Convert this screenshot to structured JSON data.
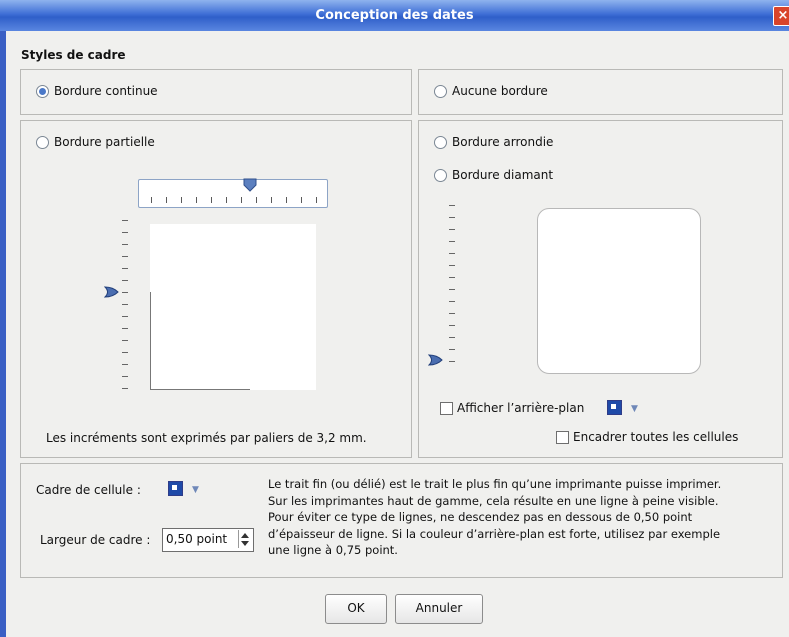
{
  "window": {
    "title": "Conception des dates",
    "close_symbol": "×"
  },
  "frame_styles": {
    "heading": "Styles de cadre",
    "continuous": {
      "label": "Bordure continue",
      "checked": true
    },
    "none": {
      "label": "Aucune bordure",
      "checked": false
    },
    "partial": {
      "label": "Bordure partielle",
      "checked": false
    },
    "rounded": {
      "label": "Bordure arrondie",
      "checked": false
    },
    "diamond": {
      "label": "Bordure diamant",
      "checked": false
    },
    "increments_note": "Les incréments sont exprimés par paliers de 3,2 mm.",
    "show_background": {
      "label": "Afficher l’arrière-plan",
      "checked": false
    },
    "frame_all_cells": {
      "label": "Encadrer toutes les cellules",
      "checked": false
    }
  },
  "cell": {
    "frame_label": "Cadre de cellule :",
    "width_label": "Largeur de cadre :",
    "width_value": "0,50 point",
    "help_text": "Le trait fin (ou délié) est le trait le plus fin qu’une imprimante puisse imprimer. Sur les imprimantes haut de gamme, cela résulte en une ligne à peine visible. Pour éviter ce type de lignes, ne descendez pas en dessous de 0,50 point d’épaisseur de ligne. Si la couleur d’arrière-plan est forte, utilisez par exemple une ligne à 0,75 point."
  },
  "buttons": {
    "ok": "OK",
    "cancel": "Annuler"
  },
  "colors": {
    "title_bar": "#3f6fd6",
    "accent": "#1f4aa8"
  }
}
